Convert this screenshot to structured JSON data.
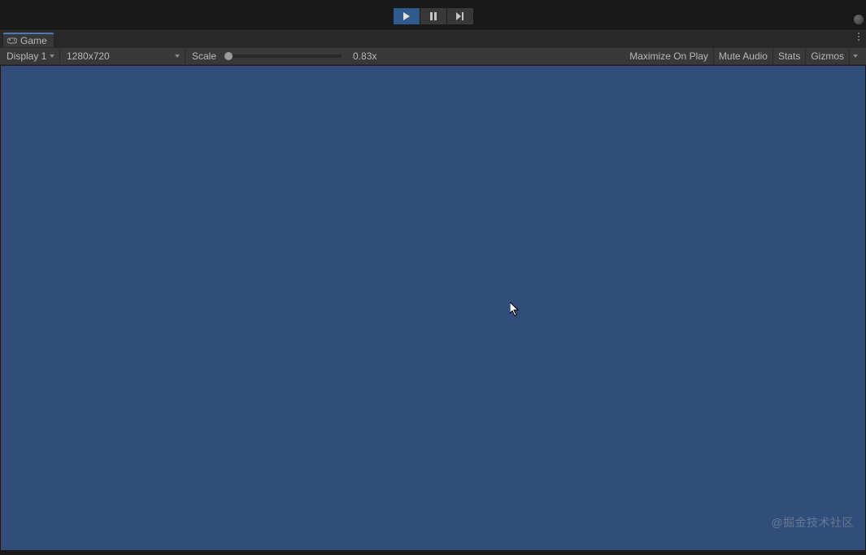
{
  "toolbar": {
    "play_active": true
  },
  "tab": {
    "label": "Game"
  },
  "controls": {
    "display": "Display 1",
    "resolution": "1280x720",
    "scale_label": "Scale",
    "scale_value": "0.83x",
    "maximize": "Maximize On Play",
    "mute": "Mute Audio",
    "stats": "Stats",
    "gizmos": "Gizmos"
  },
  "watermark": "@掘金技术社区"
}
